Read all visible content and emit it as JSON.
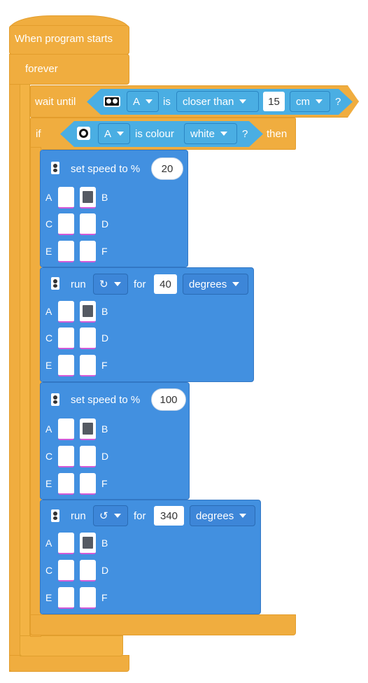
{
  "hat": {
    "label": "When program starts"
  },
  "forever": {
    "label": "forever"
  },
  "wait": {
    "prefix": "wait until",
    "port": "A",
    "is": "is",
    "comparison": "closer than",
    "value": "15",
    "unit": "cm",
    "q": "?"
  },
  "if_block": {
    "prefix": "if",
    "port": "A",
    "is_colour": "is colour",
    "colour": "white",
    "q": "?",
    "then": "then"
  },
  "ports": {
    "a": "A",
    "b": "B",
    "c": "C",
    "d": "D",
    "e": "E",
    "f": "F"
  },
  "blocks": [
    {
      "label": "set speed to %",
      "value": "20"
    },
    {
      "run": "run",
      "for": "for",
      "value": "40",
      "unit": "degrees",
      "direction": "clockwise-icon"
    },
    {
      "label": "set speed to %",
      "value": "100"
    },
    {
      "run": "run",
      "for": "for",
      "value": "340",
      "unit": "degrees",
      "direction": "counterclockwise-icon"
    }
  ],
  "colors": {
    "orange": "#f0ad3f",
    "blue": "#4290e0",
    "sensor": "#4aaee3"
  }
}
